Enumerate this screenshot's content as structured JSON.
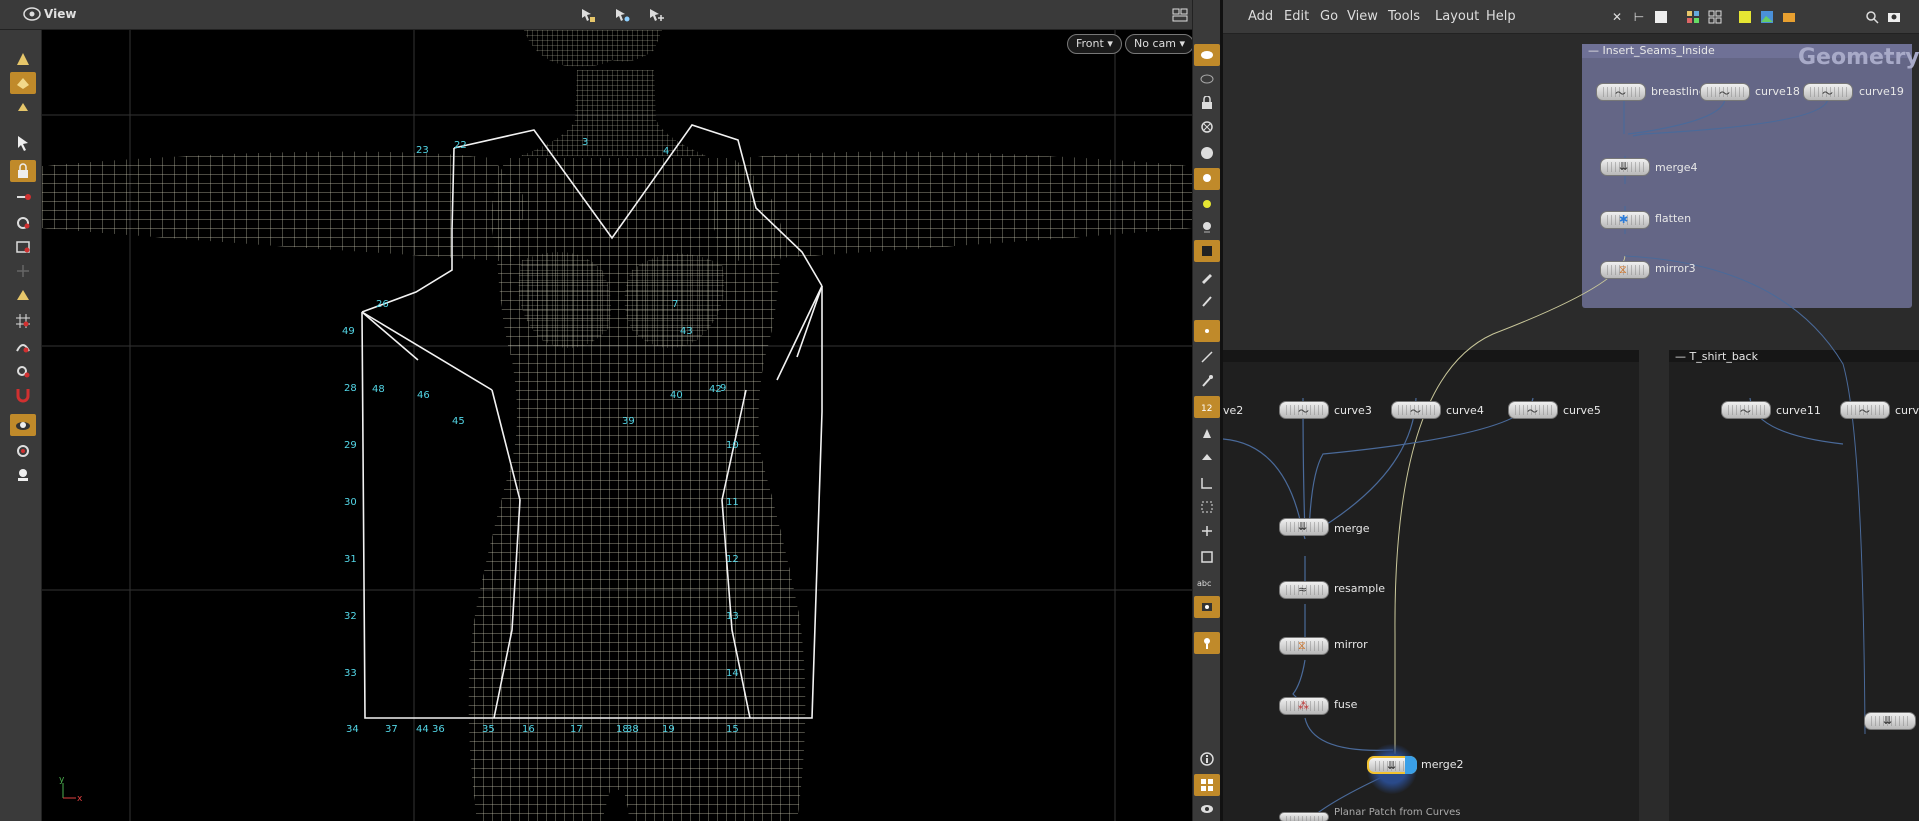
{
  "viewport_header": {
    "title": "View",
    "help_glyph": "?"
  },
  "viewport": {
    "view_dropdown": "Front",
    "camera_dropdown": "No cam",
    "axis_x": "x",
    "axis_y": "y",
    "point_labels": [
      "23",
      "22",
      "3",
      "4",
      "26",
      "7",
      "49",
      "43",
      "28",
      "48",
      "46",
      "40",
      "42",
      "9",
      "45",
      "39",
      "29",
      "10",
      "30",
      "11",
      "31",
      "12",
      "32",
      "13",
      "33",
      "14",
      "34",
      "37",
      "44",
      "36",
      "35",
      "16",
      "17",
      "18",
      "38",
      "19",
      "15"
    ]
  },
  "network": {
    "menu": [
      "Add",
      "Edit",
      "Go",
      "View",
      "Tools",
      "Layout",
      "Help"
    ],
    "context_watermark": "Geometry",
    "boxes": {
      "insert_seams": "Insert_Seams_Inside",
      "tshirt_back": "T_shirt_back"
    },
    "nodes": {
      "breastline": "breastline",
      "curve18": "curve18",
      "curve19": "curve19",
      "merge4": "merge4",
      "flatten": "flatten",
      "mirror3": "mirror3",
      "curve2_partial": "ve2",
      "curve3": "curve3",
      "curve4": "curve4",
      "curve5": "curve5",
      "merge": "merge",
      "resample": "resample",
      "mirror": "mirror",
      "fuse": "fuse",
      "merge2": "merge2",
      "planar_patch": "Planar Patch from Curves",
      "curve11": "curve11",
      "curve_partial": "curve"
    }
  },
  "colors": {
    "accent_orange": "#c08a2a",
    "wire_cyan": "#53d6e6",
    "mesh": "#c8c6b0",
    "netbox_blue": "#6f7196"
  }
}
